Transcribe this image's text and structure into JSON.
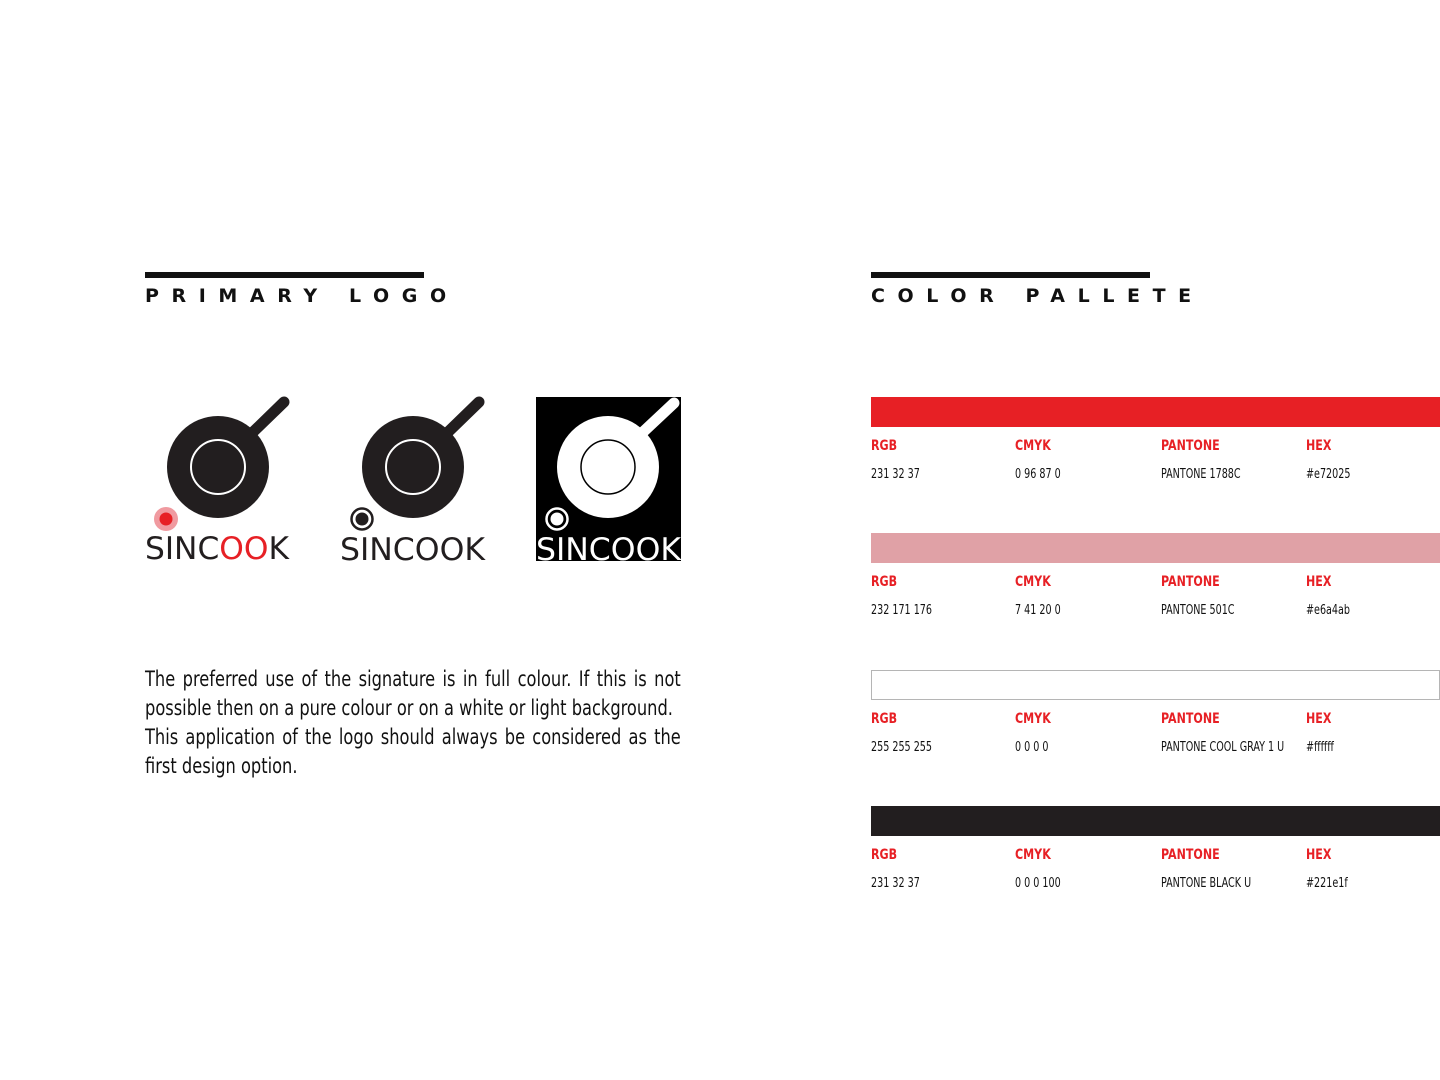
{
  "primary_logo": {
    "heading": "PRIMARY LOGO",
    "wordmark": "SINCOOK",
    "description": [
      "The preferred use of the signature is in full colour. If this is not possible then on a pure colour or on a white or light background.",
      "This application of the logo should always be considered as the first design option."
    ]
  },
  "palette": {
    "heading": "COLOR PALLETE",
    "labels": {
      "rgb": "RGB",
      "cmyk": "CMYK",
      "pantone": "PANTONE",
      "hex": "HEX"
    },
    "colors": [
      {
        "swatch": "#e72025",
        "rgb": "231 32 37",
        "cmyk": "0 96 87 0",
        "pantone": "PANTONE 1788C",
        "hex": "#e72025"
      },
      {
        "swatch": "#e0a1a6",
        "rgb": "232 171 176",
        "cmyk": "7 41 20 0",
        "pantone": "PANTONE 501C",
        "hex": "#e6a4ab"
      },
      {
        "swatch": "#ffffff",
        "rgb": "255 255 255",
        "cmyk": "0 0 0 0",
        "pantone": "PANTONE COOL GRAY 1 U",
        "hex": "#ffffff"
      },
      {
        "swatch": "#221e1f",
        "rgb": "231 32 37",
        "cmyk": "0 0 0 100",
        "pantone": "PANTONE BLACK U",
        "hex": "#221e1f"
      }
    ]
  },
  "colors": {
    "accent_red": "#e72025",
    "ink": "#221e1f",
    "dot_glow": "#f09aa0"
  }
}
